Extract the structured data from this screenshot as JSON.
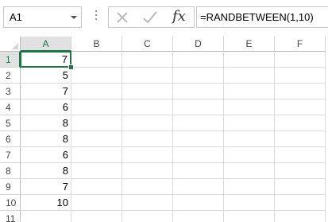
{
  "formula_bar": {
    "name_box": "A1",
    "cancel_icon": "close-icon",
    "enter_icon": "checkmark-icon",
    "insert_function_label": "fx",
    "formula": "=RANDBETWEEN(1,10)"
  },
  "sheet": {
    "columns": [
      "A",
      "B",
      "C",
      "D",
      "E",
      "F"
    ],
    "rows": [
      "1",
      "2",
      "3",
      "4",
      "5",
      "6",
      "7",
      "8",
      "9",
      "10",
      "11"
    ],
    "column_a_values": [
      "7",
      "5",
      "7",
      "6",
      "8",
      "8",
      "6",
      "8",
      "7",
      "10",
      ""
    ],
    "selected_cell": "A1",
    "accent_color": "#217346"
  }
}
